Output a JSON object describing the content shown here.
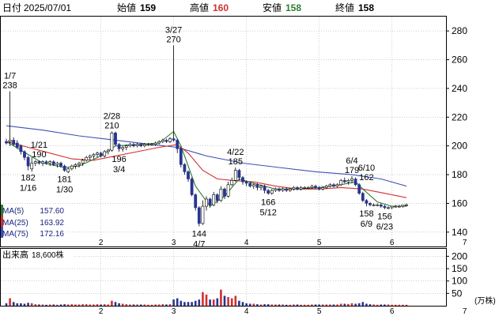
{
  "header": {
    "date_label": "日付",
    "date": "2025/07/01",
    "open_label": "始値",
    "open": "159",
    "high_label": "高値",
    "high": "160",
    "low_label": "安値",
    "low": "158",
    "close_label": "終値",
    "close": "158"
  },
  "ma_legend": [
    {
      "label": "MA(5)",
      "value": "157.60",
      "color": "#2e7d32"
    },
    {
      "label": "MA(25)",
      "value": "163.92",
      "color": "#d32f2f"
    },
    {
      "label": "MA(75)",
      "value": "172.16",
      "color": "#3f51b5"
    }
  ],
  "volume_header": {
    "label": "出来高",
    "value": "18,600株"
  },
  "volume_unit": "(万株)",
  "colors": {
    "up": "#d32f2f",
    "down": "#283593",
    "grid": "#b0b0b0",
    "ma5": "#2e7d32",
    "ma25": "#d32f2f",
    "ma75": "#3f51b5",
    "open_value": "#000000",
    "high_value": "#d32f2f",
    "low_value": "#2e7d32"
  },
  "chart_data": {
    "type": "candlestick",
    "price_axis": {
      "min": 130,
      "max": 290,
      "ticks": [
        "140",
        "160",
        "180",
        "200",
        "220",
        "240",
        "260",
        "280"
      ]
    },
    "volume_axis": {
      "min": 0,
      "max": 230,
      "ticks": [
        "50",
        "100",
        "150",
        "200"
      ]
    },
    "month_ticks": [
      {
        "label": "2",
        "day": 26
      },
      {
        "label": "3",
        "day": 46
      },
      {
        "label": "4",
        "day": 66
      },
      {
        "label": "5",
        "day": 86
      },
      {
        "label": "6",
        "day": 106
      },
      {
        "label": "7",
        "day": 126
      }
    ],
    "candles": [
      [
        0,
        203,
        205,
        201,
        202,
        10
      ],
      [
        1,
        203,
        238,
        200,
        204,
        30
      ],
      [
        2,
        204,
        206,
        200,
        201,
        15
      ],
      [
        3,
        202,
        204,
        198,
        199,
        10
      ],
      [
        4,
        200,
        201,
        194,
        196,
        10
      ],
      [
        5,
        196,
        197,
        190,
        192,
        8
      ],
      [
        6,
        192,
        193,
        183,
        186,
        12
      ],
      [
        7,
        184,
        192,
        182,
        188,
        10
      ],
      [
        8,
        188,
        190,
        186,
        189,
        6
      ],
      [
        9,
        189,
        190,
        187,
        188,
        5
      ],
      [
        10,
        188,
        190,
        186,
        189,
        5
      ],
      [
        11,
        189,
        190,
        187,
        188,
        4
      ],
      [
        12,
        188,
        190,
        186,
        189,
        5
      ],
      [
        13,
        189,
        190,
        186,
        187,
        5
      ],
      [
        14,
        187,
        189,
        185,
        188,
        4
      ],
      [
        15,
        188,
        189,
        185,
        186,
        5
      ],
      [
        16,
        186,
        187,
        182,
        183,
        6
      ],
      [
        17,
        182,
        185,
        181,
        184,
        5
      ],
      [
        18,
        184,
        187,
        183,
        186,
        6
      ],
      [
        19,
        186,
        188,
        184,
        187,
        5
      ],
      [
        20,
        187,
        189,
        185,
        188,
        5
      ],
      [
        21,
        188,
        191,
        186,
        190,
        6
      ],
      [
        22,
        190,
        193,
        189,
        192,
        6
      ],
      [
        23,
        192,
        194,
        190,
        193,
        5
      ],
      [
        24,
        193,
        195,
        191,
        194,
        5
      ],
      [
        25,
        194,
        196,
        192,
        195,
        6
      ],
      [
        26,
        195,
        196,
        192,
        193,
        5
      ],
      [
        27,
        193,
        197,
        192,
        196,
        6
      ],
      [
        28,
        196,
        198,
        194,
        197,
        5
      ],
      [
        29,
        197,
        210,
        196,
        209,
        20
      ],
      [
        30,
        209,
        210,
        200,
        201,
        15
      ],
      [
        31,
        201,
        202,
        196,
        198,
        10
      ],
      [
        32,
        198,
        200,
        196,
        199,
        8
      ],
      [
        33,
        199,
        201,
        197,
        200,
        6
      ],
      [
        34,
        200,
        202,
        199,
        201,
        5
      ],
      [
        35,
        201,
        202,
        199,
        200,
        5
      ],
      [
        36,
        200,
        202,
        199,
        201,
        5
      ],
      [
        37,
        201,
        202,
        199,
        200,
        5
      ],
      [
        38,
        200,
        202,
        199,
        201,
        5
      ],
      [
        39,
        201,
        202,
        200,
        201,
        4
      ],
      [
        40,
        201,
        202,
        200,
        201,
        4
      ],
      [
        41,
        201,
        203,
        200,
        202,
        5
      ],
      [
        42,
        202,
        204,
        201,
        203,
        5
      ],
      [
        43,
        203,
        205,
        202,
        204,
        6
      ],
      [
        44,
        204,
        205,
        202,
        203,
        5
      ],
      [
        45,
        203,
        206,
        202,
        205,
        6
      ],
      [
        46,
        205,
        270,
        203,
        204,
        25
      ],
      [
        47,
        204,
        205,
        195,
        198,
        30
      ],
      [
        48,
        198,
        199,
        185,
        187,
        20
      ],
      [
        49,
        187,
        188,
        180,
        182,
        15
      ],
      [
        50,
        182,
        183,
        175,
        177,
        15
      ],
      [
        51,
        177,
        178,
        165,
        166,
        15
      ],
      [
        52,
        166,
        167,
        155,
        157,
        20
      ],
      [
        53,
        157,
        158,
        144,
        146,
        25
      ],
      [
        54,
        146,
        162,
        145,
        158,
        55
      ],
      [
        55,
        158,
        165,
        155,
        163,
        45
      ],
      [
        56,
        163,
        164,
        157,
        159,
        25
      ],
      [
        57,
        159,
        168,
        158,
        166,
        25
      ],
      [
        58,
        166,
        167,
        160,
        162,
        30
      ],
      [
        59,
        162,
        172,
        161,
        170,
        65
      ],
      [
        60,
        170,
        171,
        163,
        165,
        40
      ],
      [
        61,
        165,
        175,
        164,
        173,
        35
      ],
      [
        62,
        173,
        178,
        172,
        176,
        30
      ],
      [
        63,
        176,
        185,
        175,
        183,
        40
      ],
      [
        64,
        183,
        184,
        176,
        178,
        20
      ],
      [
        65,
        178,
        179,
        173,
        175,
        15
      ],
      [
        66,
        175,
        176,
        172,
        174,
        10
      ],
      [
        67,
        174,
        175,
        171,
        172,
        8
      ],
      [
        68,
        172,
        174,
        170,
        173,
        8
      ],
      [
        69,
        173,
        174,
        169,
        171,
        6
      ],
      [
        70,
        171,
        173,
        169,
        172,
        5
      ],
      [
        71,
        172,
        173,
        167,
        169,
        6
      ],
      [
        72,
        169,
        170,
        166,
        167,
        6
      ],
      [
        73,
        167,
        170,
        166,
        169,
        5
      ],
      [
        74,
        169,
        171,
        168,
        170,
        5
      ],
      [
        75,
        170,
        171,
        168,
        169,
        5
      ],
      [
        76,
        169,
        171,
        168,
        170,
        5
      ],
      [
        77,
        170,
        171,
        168,
        169,
        4
      ],
      [
        78,
        169,
        171,
        168,
        170,
        4
      ],
      [
        79,
        170,
        172,
        169,
        171,
        5
      ],
      [
        80,
        171,
        172,
        169,
        170,
        5
      ],
      [
        81,
        170,
        172,
        169,
        171,
        4
      ],
      [
        82,
        171,
        172,
        170,
        171,
        4
      ],
      [
        83,
        171,
        172,
        170,
        171,
        4
      ],
      [
        84,
        171,
        173,
        170,
        172,
        5
      ],
      [
        85,
        172,
        173,
        170,
        171,
        5
      ],
      [
        86,
        171,
        172,
        169,
        170,
        5
      ],
      [
        87,
        170,
        172,
        169,
        171,
        5
      ],
      [
        88,
        171,
        173,
        170,
        172,
        5
      ],
      [
        89,
        172,
        174,
        171,
        173,
        5
      ],
      [
        90,
        173,
        174,
        171,
        172,
        5
      ],
      [
        91,
        172,
        174,
        171,
        173,
        5
      ],
      [
        92,
        173,
        177,
        172,
        176,
        8
      ],
      [
        93,
        176,
        178,
        174,
        175,
        8
      ],
      [
        94,
        175,
        177,
        173,
        176,
        7
      ],
      [
        95,
        176,
        179,
        174,
        177,
        10
      ],
      [
        96,
        177,
        178,
        172,
        173,
        8
      ],
      [
        97,
        173,
        174,
        166,
        167,
        10
      ],
      [
        98,
        167,
        168,
        161,
        162,
        15
      ],
      [
        99,
        162,
        163,
        158,
        160,
        8
      ],
      [
        100,
        160,
        161,
        158,
        159,
        6
      ],
      [
        101,
        159,
        160,
        158,
        159,
        5
      ],
      [
        102,
        159,
        160,
        158,
        159,
        4
      ],
      [
        103,
        159,
        160,
        157,
        158,
        5
      ],
      [
        104,
        158,
        159,
        156,
        157,
        5
      ],
      [
        105,
        157,
        158,
        156,
        157,
        5
      ],
      [
        106,
        157,
        158,
        156,
        158,
        4
      ],
      [
        107,
        158,
        159,
        157,
        158,
        4
      ],
      [
        108,
        158,
        159,
        157,
        158,
        4
      ],
      [
        109,
        158,
        159,
        157,
        159,
        4
      ],
      [
        110,
        159,
        160,
        158,
        159,
        4
      ]
    ],
    "ma5": [
      [
        0,
        203
      ],
      [
        6,
        194
      ],
      [
        10,
        188
      ],
      [
        16,
        185
      ],
      [
        20,
        186
      ],
      [
        26,
        193
      ],
      [
        30,
        200
      ],
      [
        36,
        201
      ],
      [
        42,
        202
      ],
      [
        46,
        210
      ],
      [
        48,
        200
      ],
      [
        52,
        172
      ],
      [
        56,
        158
      ],
      [
        60,
        165
      ],
      [
        64,
        177
      ],
      [
        68,
        174
      ],
      [
        74,
        170
      ],
      [
        80,
        170
      ],
      [
        86,
        171
      ],
      [
        92,
        173
      ],
      [
        96,
        175
      ],
      [
        98,
        170
      ],
      [
        102,
        161
      ],
      [
        106,
        158
      ],
      [
        110,
        158
      ]
    ],
    "ma25": [
      [
        0,
        203
      ],
      [
        6,
        199
      ],
      [
        12,
        195
      ],
      [
        18,
        191
      ],
      [
        24,
        190
      ],
      [
        30,
        193
      ],
      [
        36,
        196
      ],
      [
        42,
        199
      ],
      [
        47,
        201
      ],
      [
        50,
        195
      ],
      [
        54,
        183
      ],
      [
        58,
        177
      ],
      [
        62,
        176
      ],
      [
        68,
        175
      ],
      [
        74,
        172
      ],
      [
        80,
        170
      ],
      [
        86,
        170
      ],
      [
        92,
        171
      ],
      [
        98,
        170
      ],
      [
        104,
        167
      ],
      [
        110,
        164
      ]
    ],
    "ma75": [
      [
        0,
        214
      ],
      [
        10,
        211
      ],
      [
        20,
        207
      ],
      [
        30,
        204
      ],
      [
        40,
        201
      ],
      [
        47,
        199
      ],
      [
        55,
        193
      ],
      [
        65,
        188
      ],
      [
        75,
        185
      ],
      [
        85,
        182
      ],
      [
        95,
        180
      ],
      [
        103,
        177
      ],
      [
        110,
        172
      ]
    ],
    "annotations": [
      {
        "day": 1,
        "label": "1/7",
        "value": "238",
        "pos": "above"
      },
      {
        "day": 6,
        "label": "1/16",
        "value": "182",
        "pos": "below"
      },
      {
        "day": 9,
        "label": "1/21",
        "value": "190",
        "pos": "above"
      },
      {
        "day": 16,
        "label": "1/30",
        "value": "181",
        "pos": "below"
      },
      {
        "day": 29,
        "label": "2/28",
        "value": "210",
        "pos": "above"
      },
      {
        "day": 31,
        "label": "3/4",
        "value": "196",
        "pos": "below"
      },
      {
        "day": 46,
        "label": "3/27",
        "value": "270",
        "pos": "above"
      },
      {
        "day": 53,
        "label": "4/7",
        "value": "144",
        "pos": "below"
      },
      {
        "day": 63,
        "label": "4/22",
        "value": "185",
        "pos": "above"
      },
      {
        "day": 72,
        "label": "5/12",
        "value": "166",
        "pos": "below"
      },
      {
        "day": 95,
        "label": "6/4",
        "value": "179",
        "pos": "above"
      },
      {
        "day": 99,
        "label": "6/10",
        "value": "162",
        "pos": "above"
      },
      {
        "day": 99,
        "label": "6/9",
        "value": "158",
        "pos": "below"
      },
      {
        "day": 104,
        "label": "6/23",
        "value": "156",
        "pos": "below"
      }
    ]
  }
}
